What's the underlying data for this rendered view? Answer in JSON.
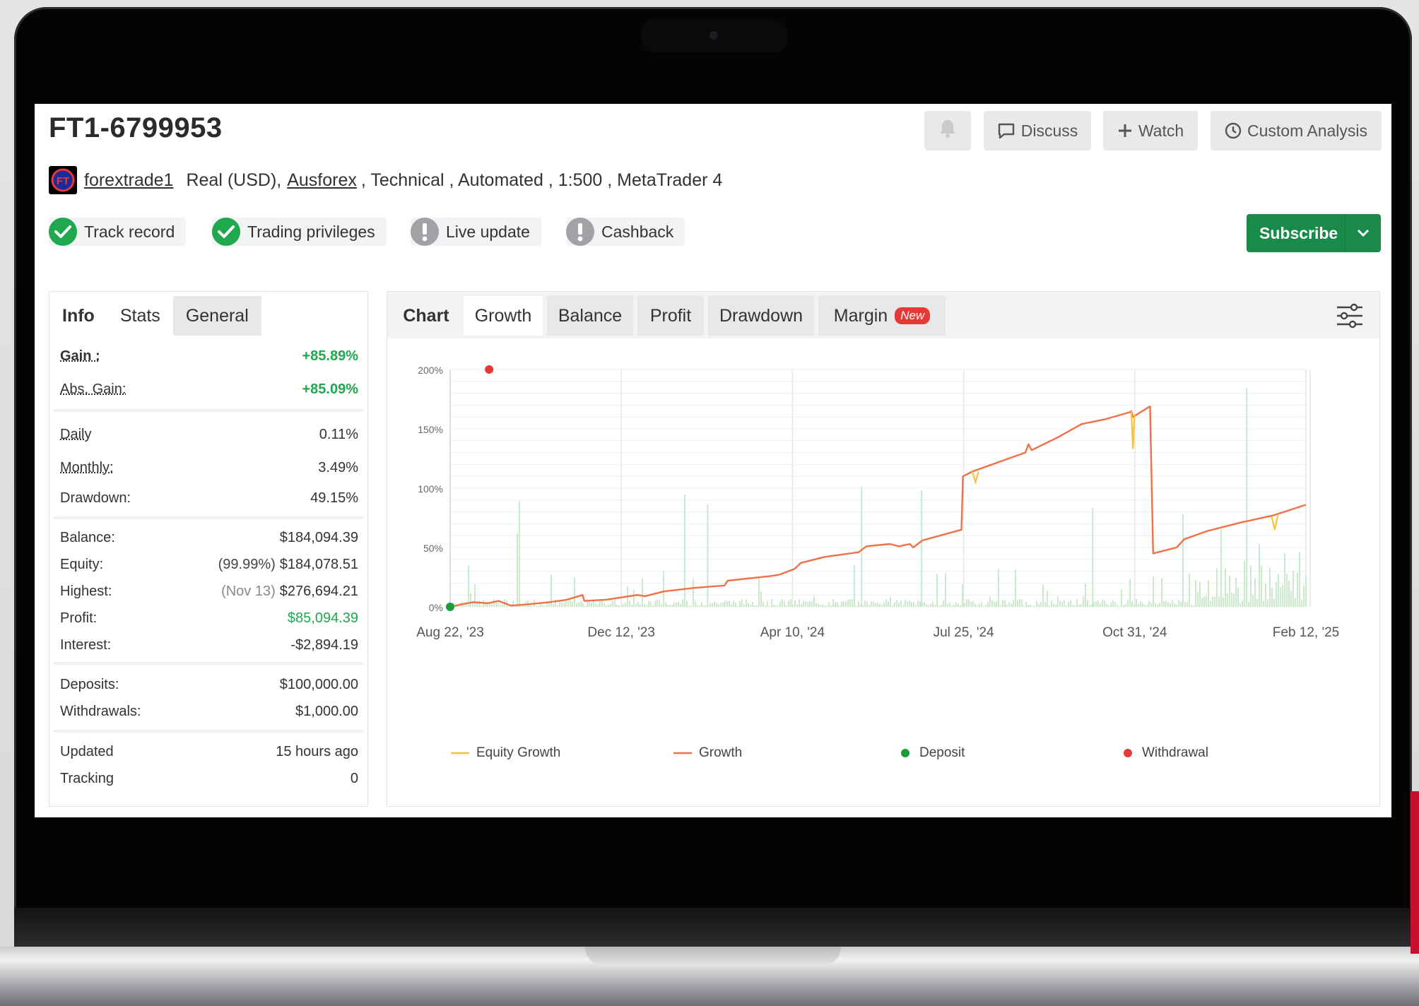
{
  "header": {
    "title": "FT1-6799953",
    "buttons": {
      "discuss": "Discuss",
      "watch": "Watch",
      "custom_analysis": "Custom Analysis"
    }
  },
  "meta": {
    "username": "forextrade1",
    "account_type": "Real (USD),",
    "broker": "Ausforex",
    "details": ", Technical , Automated , 1:500 , MetaTrader 4"
  },
  "badges": {
    "track_record": "Track record",
    "trading_privileges": "Trading privileges",
    "live_update": "Live update",
    "cashback": "Cashback"
  },
  "subscribe": {
    "label": "Subscribe"
  },
  "colors": {
    "accent_green": "#1a8a4a",
    "gain_green": "#1fa84d",
    "growth_line": "#f07048",
    "equity_line": "#f5c242",
    "deposit_dot": "#1a9e3a",
    "withdrawal_dot": "#e53935"
  },
  "panel_tabs": [
    "Info",
    "Stats",
    "General"
  ],
  "stats": {
    "gain_label": "Gain :",
    "gain_value": "+85.89%",
    "abs_gain_label": "Abs. Gain:",
    "abs_gain_value": "+85.09%",
    "daily_label": "Daily",
    "daily_value": "0.11%",
    "monthly_label": "Monthly:",
    "monthly_value": "3.49%",
    "drawdown_label": "Drawdown:",
    "drawdown_value": "49.15%",
    "balance_label": "Balance:",
    "balance_value": "$184,094.39",
    "equity_label": "Equity:",
    "equity_note": "(99.99%)",
    "equity_value": "$184,078.51",
    "highest_label": "Highest:",
    "highest_note": "(Nov 13)",
    "highest_value": "$276,694.21",
    "profit_label": "Profit:",
    "profit_value": "$85,094.39",
    "interest_label": "Interest:",
    "interest_value": "-$2,894.19",
    "deposits_label": "Deposits:",
    "deposits_value": "$100,000.00",
    "withdrawals_label": "Withdrawals:",
    "withdrawals_value": "$1,000.00",
    "updated_label": "Updated",
    "updated_value": "15 hours ago",
    "tracking_label": "Tracking",
    "tracking_value": "0"
  },
  "chart_tabs": {
    "chart": "Chart",
    "growth": "Growth",
    "balance": "Balance",
    "profit": "Profit",
    "drawdown": "Drawdown",
    "margin": "Margin",
    "new_badge": "New"
  },
  "chart_data": {
    "type": "line",
    "x_tick_labels": [
      "Aug 22, '23",
      "Dec 12, '23",
      "Apr 10, '24",
      "Jul 25, '24",
      "Oct 31, '24",
      "Feb 12, '25"
    ],
    "y_tick_labels": [
      "0%",
      "50%",
      "100%",
      "150%",
      "200%"
    ],
    "ylim": [
      0,
      200
    ],
    "grid": true,
    "x_range": [
      "2023-08-22",
      "2025-02-21"
    ],
    "legend_position": "bottom",
    "series": [
      {
        "name": "Growth",
        "color": "#f07048",
        "points": [
          [
            "2023-08-22",
            0
          ],
          [
            "2023-08-29",
            2
          ],
          [
            "2023-09-06",
            4
          ],
          [
            "2023-09-15",
            3
          ],
          [
            "2023-09-22",
            5
          ],
          [
            "2023-09-30",
            1
          ],
          [
            "2023-10-10",
            2
          ],
          [
            "2023-10-25",
            4
          ],
          [
            "2023-11-05",
            6
          ],
          [
            "2023-11-15",
            10
          ],
          [
            "2023-11-16",
            5
          ],
          [
            "2023-11-30",
            6
          ],
          [
            "2023-12-20",
            10
          ],
          [
            "2023-12-25",
            9
          ],
          [
            "2024-01-06",
            13
          ],
          [
            "2024-01-26",
            16
          ],
          [
            "2024-02-14",
            18
          ],
          [
            "2024-02-16",
            22
          ],
          [
            "2024-03-15",
            26
          ],
          [
            "2024-03-20",
            27
          ],
          [
            "2024-03-30",
            32
          ],
          [
            "2024-04-03",
            37
          ],
          [
            "2024-04-18",
            42
          ],
          [
            "2024-05-10",
            46
          ],
          [
            "2024-05-15",
            51
          ],
          [
            "2024-05-30",
            53
          ],
          [
            "2024-06-05",
            51
          ],
          [
            "2024-06-12",
            53
          ],
          [
            "2024-06-14",
            50
          ],
          [
            "2024-06-20",
            56
          ],
          [
            "2024-07-15",
            65
          ],
          [
            "2024-07-16",
            110
          ],
          [
            "2024-07-22",
            114
          ],
          [
            "2024-08-10",
            123
          ],
          [
            "2024-08-25",
            130
          ],
          [
            "2024-08-27",
            137
          ],
          [
            "2024-08-29",
            132
          ],
          [
            "2024-09-15",
            143
          ],
          [
            "2024-09-30",
            154
          ],
          [
            "2024-10-15",
            158
          ],
          [
            "2024-10-31",
            164
          ],
          [
            "2024-11-01",
            165
          ],
          [
            "2024-11-02",
            160
          ],
          [
            "2024-11-13",
            169
          ],
          [
            "2024-11-15",
            45
          ],
          [
            "2024-11-30",
            50
          ],
          [
            "2024-12-05",
            57
          ],
          [
            "2024-12-20",
            64
          ],
          [
            "2025-01-10",
            71
          ],
          [
            "2025-01-31",
            77
          ],
          [
            "2025-02-21",
            86
          ]
        ]
      },
      {
        "name": "Equity Growth",
        "color": "#f5c242",
        "points": [
          [
            "2024-07-22",
            114
          ],
          [
            "2024-07-24",
            105
          ],
          [
            "2024-07-26",
            114
          ],
          [
            "2024-11-01",
            165
          ],
          [
            "2024-11-02",
            133
          ],
          [
            "2024-11-03",
            162
          ],
          [
            "2025-01-30",
            76
          ],
          [
            "2025-02-01",
            65
          ],
          [
            "2025-02-03",
            77
          ]
        ]
      },
      {
        "name": "Deposit",
        "color": "#1a9e3a",
        "points": [
          [
            "2023-08-22",
            0
          ]
        ]
      },
      {
        "name": "Withdrawal",
        "color": "#e53935",
        "points": [
          [
            "2023-09-16",
            200
          ]
        ]
      }
    ],
    "bars_color": "#cbe9cb"
  },
  "legend": {
    "equity_growth": "Equity Growth",
    "growth": "Growth",
    "deposit": "Deposit",
    "withdrawal": "Withdrawal"
  },
  "icons": {
    "bell": "bell-icon",
    "discuss": "speech-bubble-icon",
    "watch": "plus-icon",
    "custom_analysis": "clock-icon",
    "settings": "sliders-icon"
  }
}
